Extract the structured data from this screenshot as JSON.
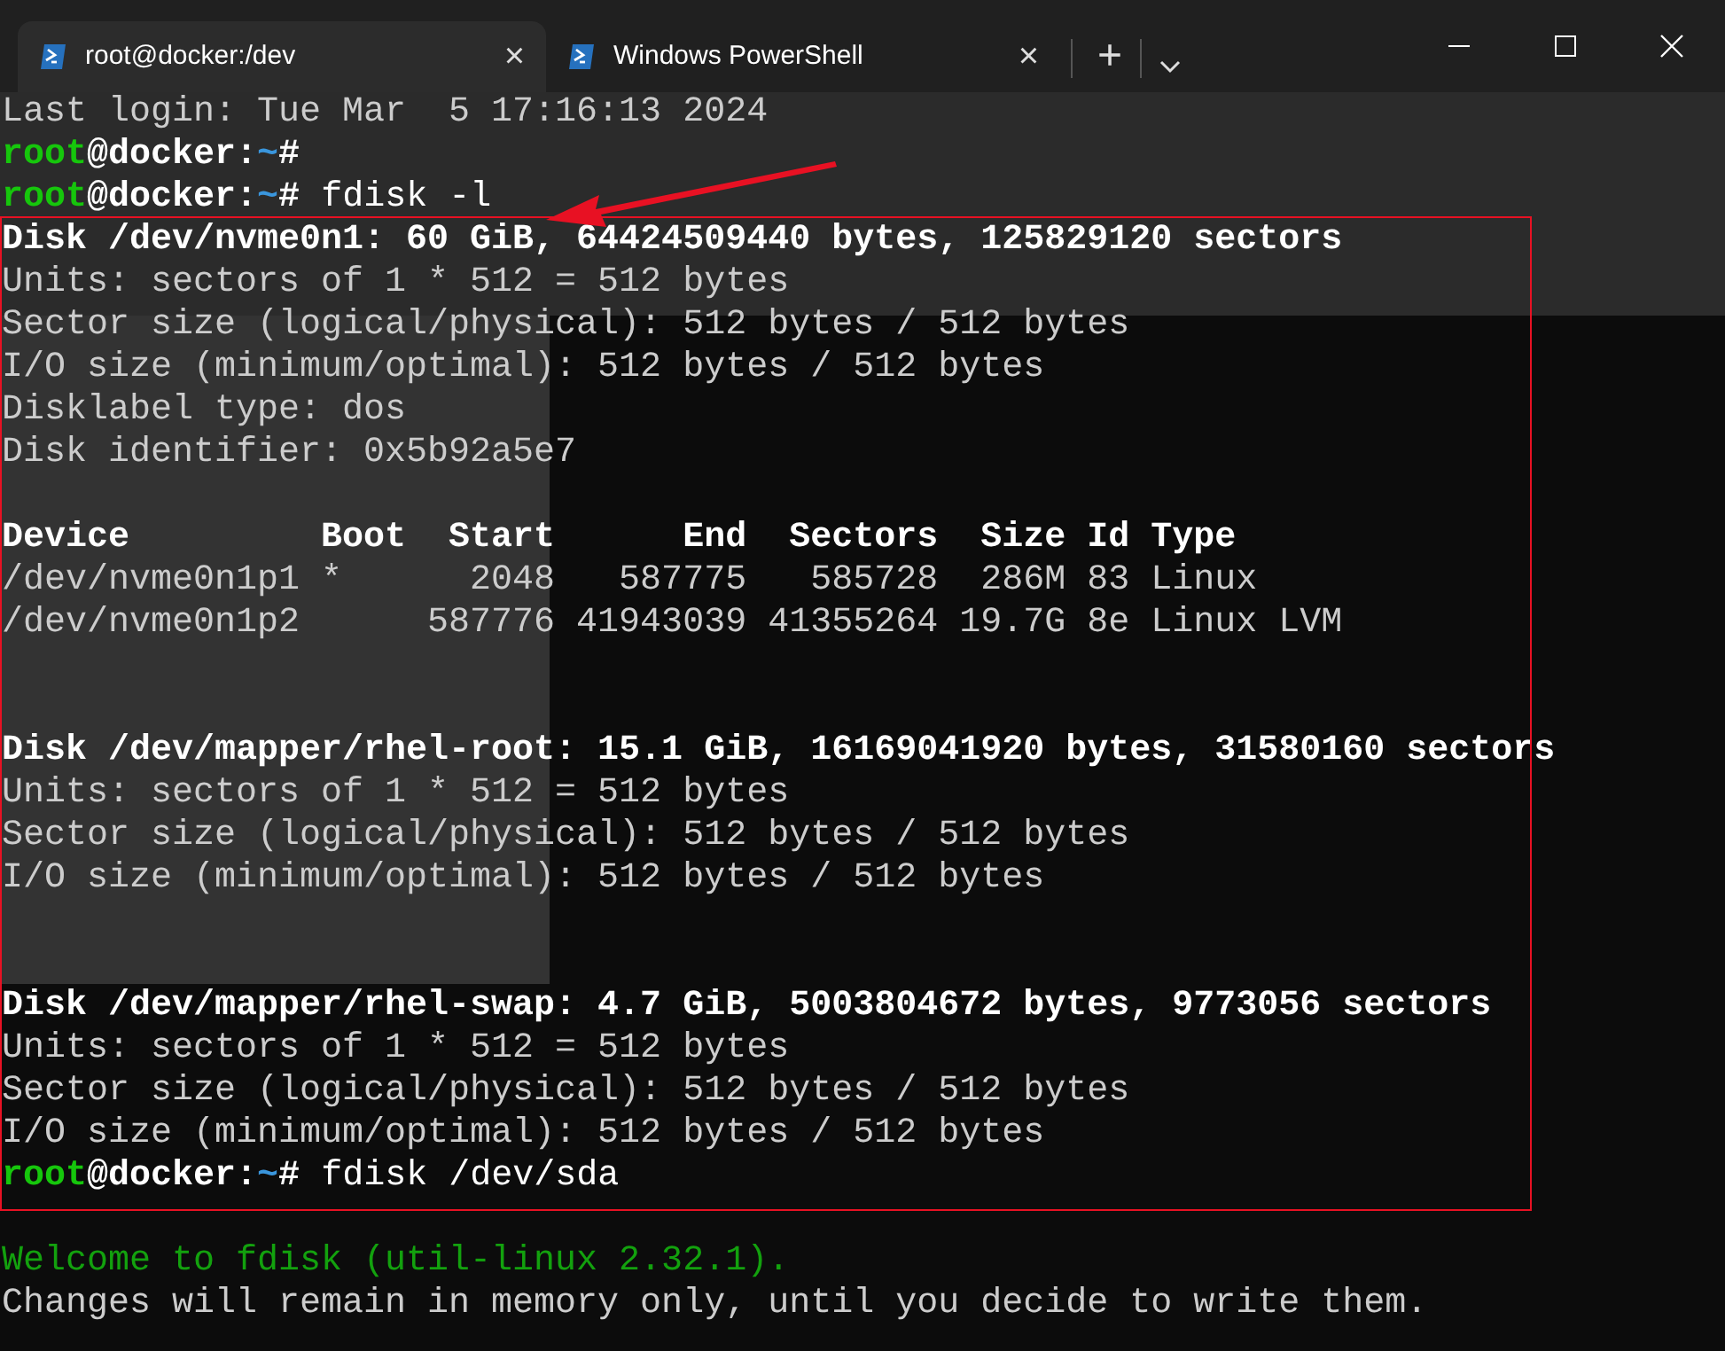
{
  "tabs": [
    {
      "title": "root@docker:/dev",
      "close": "×",
      "selected": true
    },
    {
      "title": "Windows PowerShell",
      "close": "×",
      "selected": false
    }
  ],
  "new_tab": "+",
  "terminal": {
    "lines": [
      {
        "kind": "plain",
        "text": "Last login: Tue Mar  5 17:16:13 2024"
      },
      {
        "kind": "prompt",
        "user": "root",
        "host": "@docker:",
        "path": "~",
        "symbol": "#"
      },
      {
        "kind": "prompt",
        "user": "root",
        "host": "@docker:",
        "path": "~",
        "symbol": "#",
        "command": " fdisk -l"
      },
      {
        "kind": "bold",
        "text": "Disk /dev/nvme0n1: 60 GiB, 64424509440 bytes, 125829120 sectors"
      },
      {
        "kind": "plain",
        "text": "Units: sectors of 1 * 512 = 512 bytes"
      },
      {
        "kind": "plain",
        "text": "Sector size (logical/physical): 512 bytes / 512 bytes"
      },
      {
        "kind": "plain",
        "text": "I/O size (minimum/optimal): 512 bytes / 512 bytes"
      },
      {
        "kind": "plain",
        "text": "Disklabel type: dos"
      },
      {
        "kind": "plain",
        "text": "Disk identifier: 0x5b92a5e7"
      },
      {
        "kind": "blank"
      },
      {
        "kind": "bold",
        "text": "Device         Boot  Start      End  Sectors  Size Id Type"
      },
      {
        "kind": "plain",
        "text": "/dev/nvme0n1p1 *      2048   587775   585728  286M 83 Linux"
      },
      {
        "kind": "plain",
        "text": "/dev/nvme0n1p2      587776 41943039 41355264 19.7G 8e Linux LVM"
      },
      {
        "kind": "blank"
      },
      {
        "kind": "blank"
      },
      {
        "kind": "bold",
        "text": "Disk /dev/mapper/rhel-root: 15.1 GiB, 16169041920 bytes, 31580160 sectors"
      },
      {
        "kind": "plain",
        "text": "Units: sectors of 1 * 512 = 512 bytes"
      },
      {
        "kind": "plain",
        "text": "Sector size (logical/physical): 512 bytes / 512 bytes"
      },
      {
        "kind": "plain",
        "text": "I/O size (minimum/optimal): 512 bytes / 512 bytes"
      },
      {
        "kind": "blank"
      },
      {
        "kind": "blank"
      },
      {
        "kind": "bold",
        "text": "Disk /dev/mapper/rhel-swap: 4.7 GiB, 5003804672 bytes, 9773056 sectors"
      },
      {
        "kind": "plain",
        "text": "Units: sectors of 1 * 512 = 512 bytes"
      },
      {
        "kind": "plain",
        "text": "Sector size (logical/physical): 512 bytes / 512 bytes"
      },
      {
        "kind": "plain",
        "text": "I/O size (minimum/optimal): 512 bytes / 512 bytes"
      },
      {
        "kind": "prompt",
        "user": "root",
        "host": "@docker:",
        "path": "~",
        "symbol": "#",
        "command": " fdisk /dev/sda"
      },
      {
        "kind": "blank"
      },
      {
        "kind": "green",
        "text": "Welcome to fdisk (util-linux 2.32.1)."
      },
      {
        "kind": "plain",
        "text": "Changes will remain in memory only, until you decide to write them."
      }
    ]
  }
}
